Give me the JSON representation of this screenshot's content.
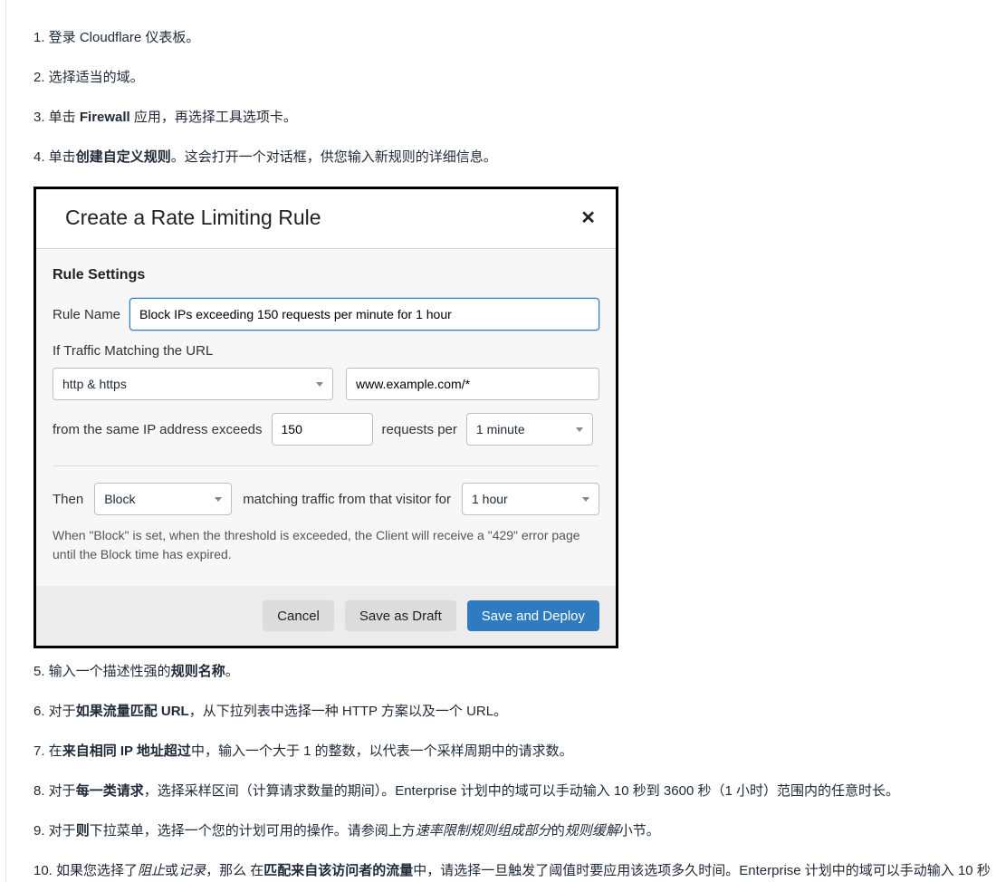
{
  "steps": {
    "s1": "1. 登录 Cloudflare 仪表板。",
    "s2": "2. 选择适当的域。",
    "s3_pre": "3. 单击 ",
    "s3_bold": "Firewall",
    "s3_post": " 应用，再选择工具选项卡。",
    "s4_pre": "4. 单击",
    "s4_bold": "创建自定义规则",
    "s4_post": "。这会打开一个对话框，供您输入新规则的详细信息。",
    "s5_pre": "5. 输入一个描述性强的",
    "s5_bold": "规则名称",
    "s5_post": "。",
    "s6_pre": "6. 对于",
    "s6_bold": "如果流量匹配 URL",
    "s6_post": "，从下拉列表中选择一种 HTTP 方案以及一个 URL。",
    "s7_pre": "7. 在",
    "s7_bold": "来自相同 IP 地址超过",
    "s7_post": "中，输入一个大于 1 的整数，以代表一个采样周期中的请求数。",
    "s8_pre": "8. 对于",
    "s8_bold": "每一类请求",
    "s8_post": "，选择采样区间（计算请求数量的期间）。Enterprise 计划中的域可以手动输入 10 秒到 3600 秒（1 小时）范围内的任意时长。",
    "s9_pre": "9. 对于",
    "s9_bold": "则",
    "s9_mid": "下拉菜单，选择一个您的计划可用的操作。请参阅上方",
    "s9_em1": "速率限制规则组成部分",
    "s9_mid2": "的",
    "s9_em2": "规则缓解",
    "s9_post": "小节。",
    "s10_pre": "10. 如果您选择了",
    "s10_em1": "阻止",
    "s10_mid1": "或",
    "s10_em2": "记录",
    "s10_mid2": "，那么 在",
    "s10_bold": "匹配来自该访问者的流量",
    "s10_post": "中，请选择一旦触发了阈值时要应用该选项多久时间。Enterprise 计划中的域可以手动输入 10 秒"
  },
  "modal": {
    "title": "Create a Rate Limiting Rule",
    "close": "✕",
    "section_title": "Rule Settings",
    "rule_name_label": "Rule Name",
    "rule_name_value": "Block IPs exceeding 150 requests per minute for 1 hour",
    "traffic_label": "If Traffic Matching the URL",
    "scheme_value": "http & https",
    "url_value": "www.example.com/*",
    "from_same_ip": "from the same IP address exceeds",
    "threshold_value": "150",
    "requests_per": "requests per",
    "period_value": "1 minute",
    "then_label": "Then",
    "action_value": "Block",
    "matching_for": "matching traffic from that visitor for",
    "duration_value": "1 hour",
    "helper": "When \"Block\" is set, when the threshold is exceeded, the Client will receive a \"429\" error page until the Block time has expired.",
    "cancel": "Cancel",
    "draft": "Save as Draft",
    "deploy": "Save and Deploy"
  }
}
